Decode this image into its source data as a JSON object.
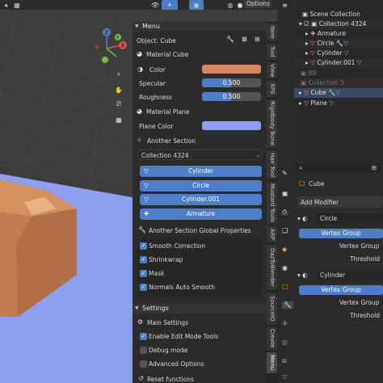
{
  "viewport_header": {
    "options_label": "Options"
  },
  "gizmo": {
    "x": "X",
    "y": "Y",
    "z": "Z"
  },
  "panel": {
    "menu_title": "Menu",
    "object_label": "Object: Cube",
    "material_cube_label": "Material Cube",
    "color_label": "Color",
    "specular_label": "Specular",
    "specular_value": "0.500",
    "roughness_label": "Roughness",
    "roughness_value": "0.500",
    "material_plane_label": "Material Plane",
    "plane_color_label": "Plane Color",
    "another_section_label": "Another Section",
    "collection_dropdown": "Collection 4324",
    "collection_buttons": [
      "Cylinder",
      "Circle",
      "Cylinder.001",
      "Armature"
    ],
    "global_props_label": "Another Section Global Properties",
    "checkboxes": [
      {
        "label": "Smooth Correction",
        "checked": true
      },
      {
        "label": "Shrinkwrap",
        "checked": true
      },
      {
        "label": "Mask",
        "checked": true
      },
      {
        "label": "Normals Auto Smooth",
        "checked": true
      }
    ],
    "settings_title": "Settings",
    "main_settings_label": "Main Settings",
    "settings_checkboxes": [
      {
        "label": "Enable Edit Mode Tools",
        "checked": true
      },
      {
        "label": "Debug mode",
        "checked": false
      },
      {
        "label": "Advanced Options",
        "checked": false
      }
    ],
    "reset_label": "Reset functions",
    "colors": {
      "cube_color": "#d6875e",
      "plane_color": "#8f9ff0"
    }
  },
  "tabs": [
    "Menu",
    "Create",
    "SourceIO",
    "DazToBlender",
    "ARP",
    "Mustard Tools",
    "Hair Tool",
    "Rigidbody Bone",
    "XPS",
    "View",
    "Tool",
    "Item"
  ],
  "outliner": {
    "rows": [
      "Scene Collection",
      "Collection 4324",
      "Armature",
      "Circle",
      "Cylinder",
      "Cylinder.001",
      "BB",
      "Collection 3",
      "Cube",
      "Plane"
    ]
  },
  "properties": {
    "object_name": "Cube",
    "add_modifier_label": "Add Modifier",
    "modifiers": [
      {
        "name": "Circle",
        "type_label": "Vertex Group",
        "vg_label": "Vertex Group",
        "threshold_label": "Threshold"
      },
      {
        "name": "Cylinder",
        "type_label": "Vertex Group",
        "vg_label": "Vertex Group",
        "threshold_label": "Threshold"
      }
    ]
  }
}
